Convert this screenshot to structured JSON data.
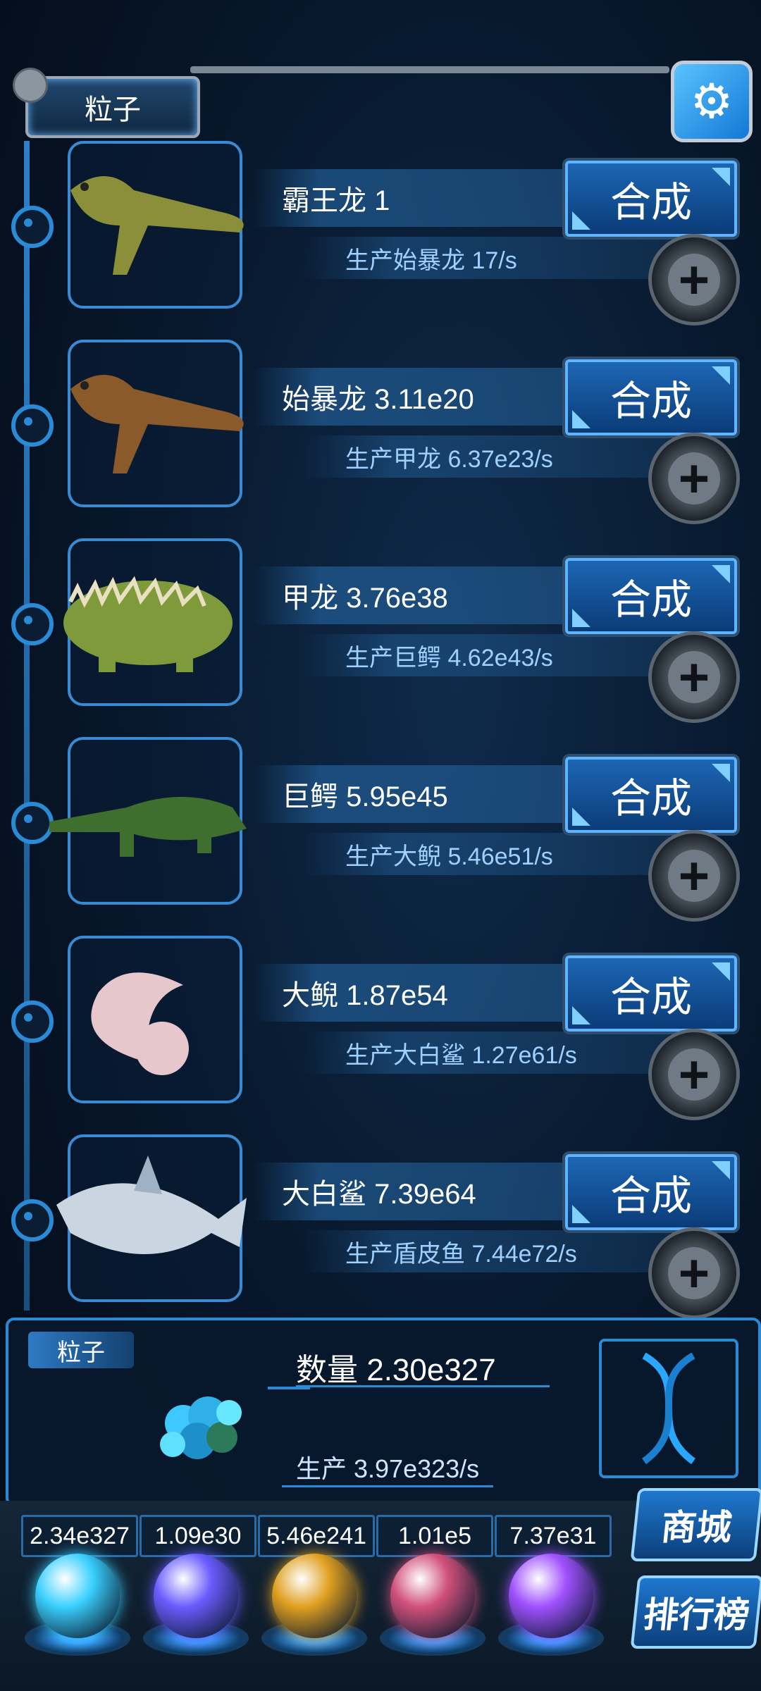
{
  "header": {
    "title": "粒子",
    "settings_icon": "gear-icon"
  },
  "rows": [
    {
      "name": "霸王龙 1",
      "rate": "生产始暴龙 17/s",
      "craft_label": "合成",
      "creature": "tyrannosaurus"
    },
    {
      "name": "始暴龙 3.11e20",
      "rate": "生产甲龙 6.37e23/s",
      "craft_label": "合成",
      "creature": "eotyrannus"
    },
    {
      "name": "甲龙 3.76e38",
      "rate": "生产巨鳄 4.62e43/s",
      "craft_label": "合成",
      "creature": "ankylosaurus"
    },
    {
      "name": "巨鳄 5.95e45",
      "rate": "生产大鲵 5.46e51/s",
      "craft_label": "合成",
      "creature": "crocodile"
    },
    {
      "name": "大鲵 1.87e54",
      "rate": "生产大白鲨 1.27e61/s",
      "craft_label": "合成",
      "creature": "axolotl"
    },
    {
      "name": "大白鲨 7.39e64",
      "rate": "生产盾皮鱼 7.44e72/s",
      "craft_label": "合成",
      "creature": "shark"
    }
  ],
  "panel": {
    "tag": "粒子",
    "count": "数量 2.30e327",
    "rate": "生产 3.97e323/s"
  },
  "tabs": [
    {
      "value": "2.34e327",
      "orb": "particle-orb"
    },
    {
      "value": "1.09e30",
      "orb": "lightning-orb"
    },
    {
      "value": "5.46e241",
      "orb": "fire-orb"
    },
    {
      "value": "1.01e5",
      "orb": "brain-orb"
    },
    {
      "value": "7.37e31",
      "orb": "vortex-orb"
    }
  ],
  "side_buttons": {
    "shop": "商城",
    "rank": "排行榜"
  }
}
